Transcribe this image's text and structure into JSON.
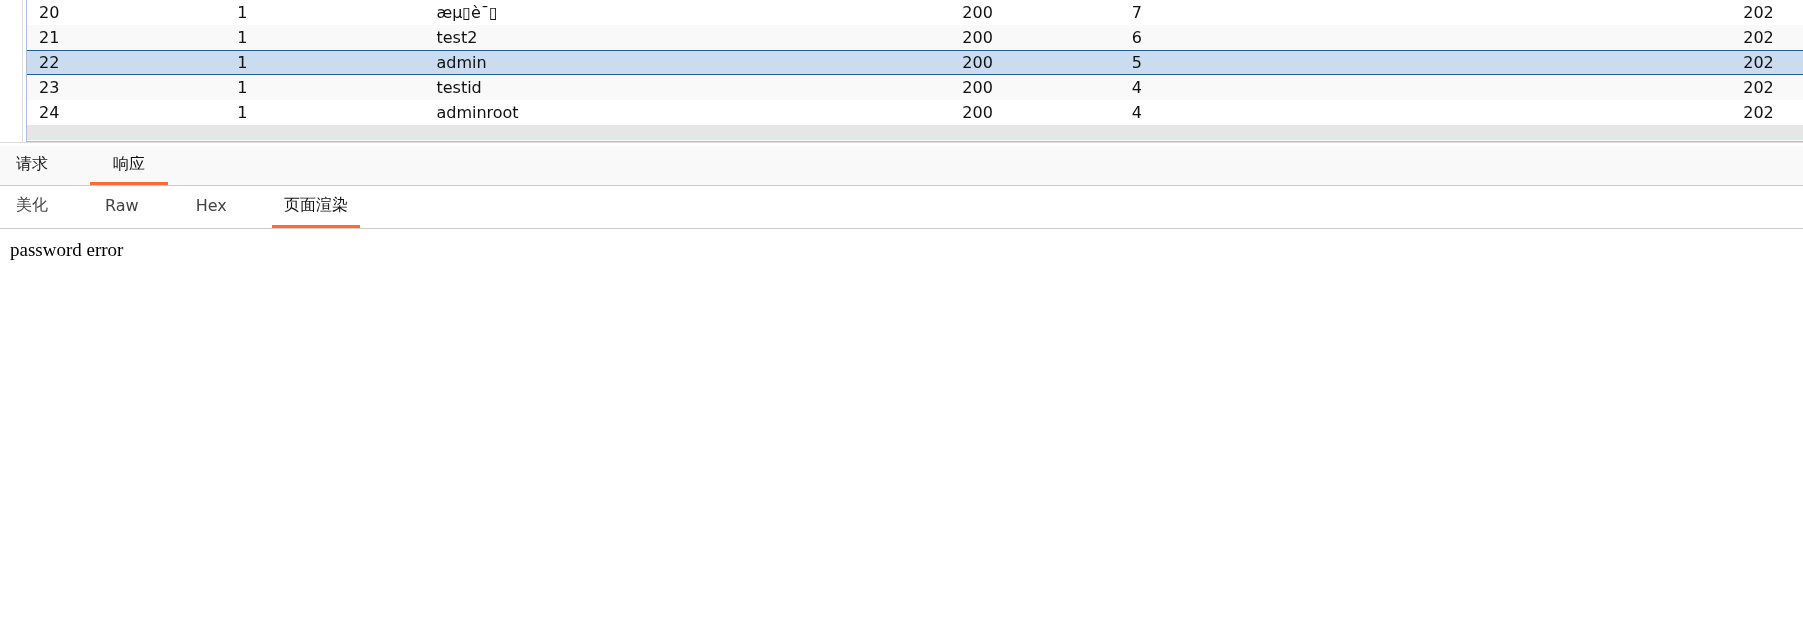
{
  "table": {
    "rows": [
      {
        "cells": [
          "20",
          "1",
          "æµ▯è¯▯",
          "200",
          "7",
          "202"
        ],
        "selected": false
      },
      {
        "cells": [
          "21",
          "1",
          "test2",
          "200",
          "6",
          "202"
        ],
        "selected": false
      },
      {
        "cells": [
          "22",
          "1",
          "admin",
          "200",
          "5",
          "202"
        ],
        "selected": true
      },
      {
        "cells": [
          "23",
          "1",
          "testid",
          "200",
          "4",
          "202"
        ],
        "selected": false
      },
      {
        "cells": [
          "24",
          "1",
          "adminroot",
          "200",
          "4",
          "202"
        ],
        "selected": false
      }
    ]
  },
  "main_tabs": [
    {
      "label": "请求",
      "selected": false
    },
    {
      "label": "响应",
      "selected": true
    }
  ],
  "view_tabs": [
    {
      "label": "美化",
      "selected": false
    },
    {
      "label": "Raw",
      "selected": false
    },
    {
      "label": "Hex",
      "selected": false
    },
    {
      "label": "页面渲染",
      "selected": true
    }
  ],
  "rendered_page": {
    "text": "password error"
  }
}
